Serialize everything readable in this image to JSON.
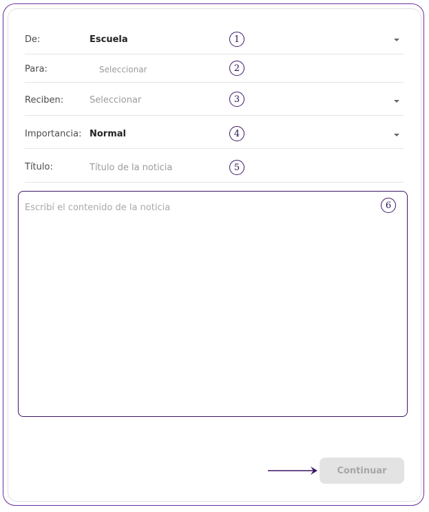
{
  "form": {
    "from": {
      "label": "De:",
      "value": "Escuela",
      "marker": "1"
    },
    "to": {
      "label": "Para:",
      "placeholder": "Seleccionar",
      "marker": "2"
    },
    "recipients": {
      "label": "Reciben:",
      "placeholder": "Seleccionar",
      "marker": "3"
    },
    "importance": {
      "label": "Importancia:",
      "value": "Normal",
      "marker": "4"
    },
    "title": {
      "label": "Título:",
      "placeholder": "Título de la noticia",
      "marker": "5"
    },
    "content": {
      "placeholder": "Escribí el contenido de la noticia",
      "marker": "6"
    }
  },
  "actions": {
    "continue_label": "Continuar"
  },
  "colors": {
    "accent": "#3b1466",
    "outer_border": "#6a2c9c",
    "button_disabled": "#e3e3e3"
  }
}
